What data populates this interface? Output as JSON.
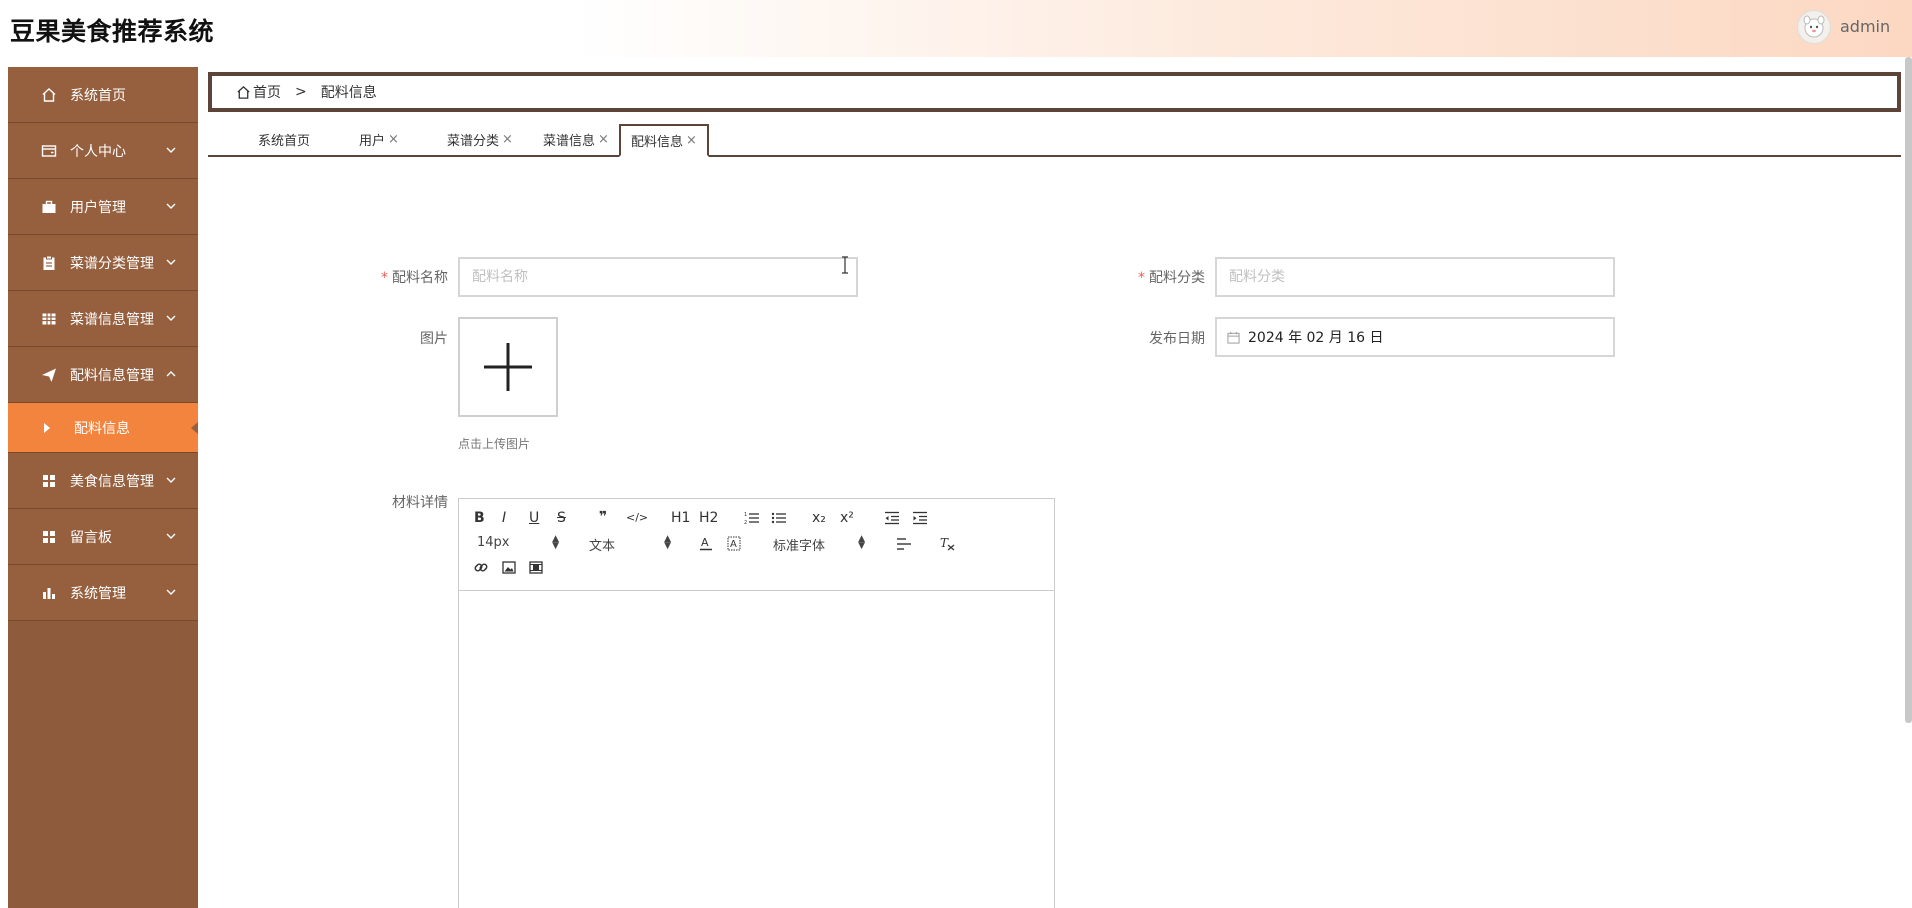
{
  "app": {
    "title": "豆果美食推荐系统",
    "user": "admin"
  },
  "sidebar": {
    "items": [
      {
        "label": "系统首页",
        "icon": "home-icon"
      },
      {
        "label": "个人中心",
        "icon": "wallet-icon"
      },
      {
        "label": "用户管理",
        "icon": "briefcase-icon"
      },
      {
        "label": "菜谱分类管理",
        "icon": "clipboard-icon"
      },
      {
        "label": "菜谱信息管理",
        "icon": "table-icon"
      },
      {
        "label": "配料信息管理",
        "icon": "paper-plane-icon"
      },
      {
        "label": "美食信息管理",
        "icon": "grid-icon"
      },
      {
        "label": "留言板",
        "icon": "grid-icon"
      },
      {
        "label": "系统管理",
        "icon": "bar-chart-icon"
      }
    ],
    "subitem": {
      "label": "配料信息"
    }
  },
  "breadcrumb": {
    "home": "首页",
    "separator": ">",
    "current": "配料信息"
  },
  "tabs": [
    {
      "label": "系统首页",
      "closable": false
    },
    {
      "label": "用户",
      "closable": true
    },
    {
      "label": "菜谱分类",
      "closable": true
    },
    {
      "label": "菜谱信息",
      "closable": true
    },
    {
      "label": "配料信息",
      "closable": true,
      "active": true
    }
  ],
  "close_glyph": "×",
  "form": {
    "name_label": "配料名称",
    "name_placeholder": "配料名称",
    "category_label": "配料分类",
    "category_placeholder": "配料分类",
    "image_label": "图片",
    "upload_tip": "点击上传图片",
    "date_label": "发布日期",
    "date_value": "2024 年 02 月 16 日",
    "detail_label": "材料详情",
    "required_mark": "*"
  },
  "editor": {
    "buttons": {
      "bold": "B",
      "italic": "I",
      "underline": "U",
      "strike": "S",
      "quote": "❞",
      "code": "</>",
      "h1": "H1",
      "h2": "H2",
      "sub": "x₂",
      "sup": "x²"
    },
    "font_size": "14px",
    "heading": "文本",
    "font_family": "标准字体"
  },
  "colors": {
    "sidebar": "#96603f",
    "active": "#f2843e",
    "border": "#5c4538",
    "required": "#e9605a"
  }
}
